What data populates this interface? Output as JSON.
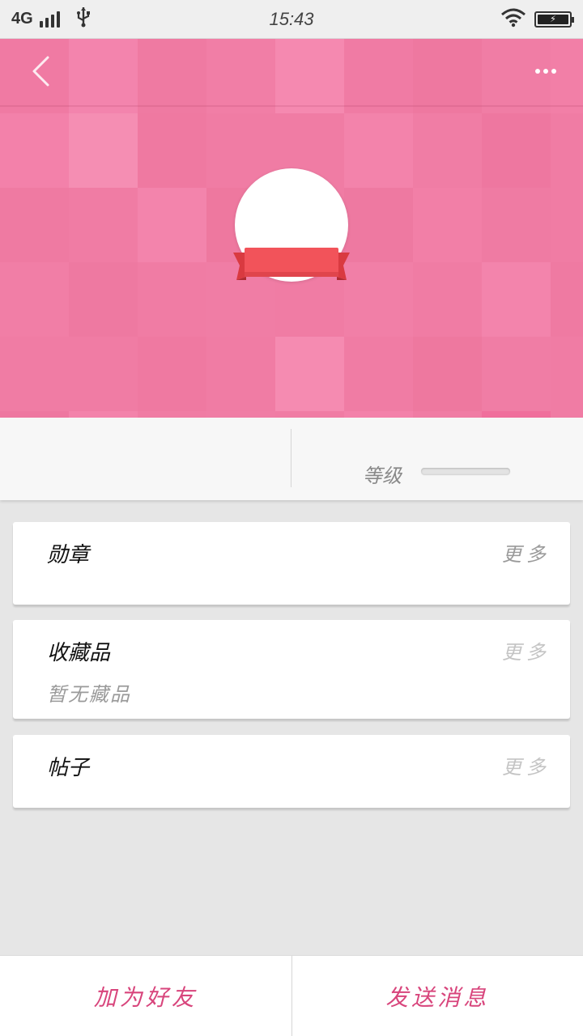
{
  "status_bar": {
    "network": "4G",
    "time": "15:43",
    "signal_icon": "signal-icon",
    "usb_icon": "usb-icon",
    "wifi_icon": "wifi-icon",
    "battery_icon": "battery-charging-icon"
  },
  "header": {
    "back_icon": "chevron-left-icon",
    "more_icon": "more-dots-icon",
    "background_color": "#f07ea6",
    "ribbon_color": "#f2535a"
  },
  "stats": {
    "level_label": "等级"
  },
  "sections": {
    "medals": {
      "title": "勋章",
      "more": "更多"
    },
    "collection": {
      "title": "收藏品",
      "more": "更多",
      "empty": "暂无藏品"
    },
    "posts": {
      "title": "帖子",
      "more": "更多"
    }
  },
  "actions": {
    "add_friend": "加为好友",
    "send_message": "发送消息",
    "accent_color": "#d8457c"
  }
}
